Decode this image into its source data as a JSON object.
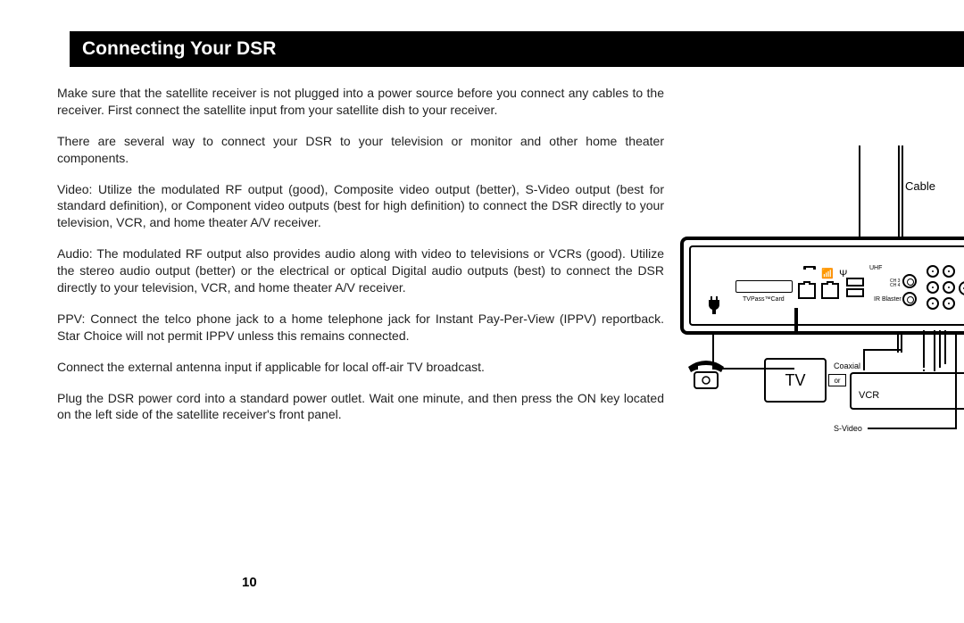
{
  "header": {
    "title": "Connecting Your DSR"
  },
  "paragraphs": {
    "p1": "Make sure that the satellite receiver is not plugged into a power source before you connect any cables to the receiver. First connect the satellite input from your satellite dish to your receiver.",
    "p2": "There are several way to connect your DSR to your television or monitor and other home theater components.",
    "p3": "Video: Utilize the modulated RF output (good), Composite video output (better), S-Video output (best for standard definition), or Component video outputs (best for high definition) to connect the DSR directly to your television, VCR, and home theater A/V receiver.",
    "p4": "Audio: The modulated RF output also provides audio along with video to televisions or VCRs (good). Utilize the stereo audio output (better) or the electrical or optical Digital audio outputs (best) to connect the DSR directly to your television, VCR, and home theater A/V receiver.",
    "p5": "PPV: Connect the telco phone jack to a home telephone jack for Instant Pay-Per-View (IPPV) reportback.  Star Choice will not permit IPPV unless this remains connected.",
    "p6": "Connect the external antenna input if applicable for local off-air TV broadcast.",
    "p7": "Plug the DSR power cord into a standard power outlet. Wait one minute, and then press the ON key located on the left side of the satellite receiver's front panel."
  },
  "page_number": "10",
  "diagram": {
    "cable_label": "Cable",
    "card_slot": "TVPass™Card",
    "uhf": "UHF",
    "ir_blaster": "IR\nBlaster",
    "ch3": "CH 3",
    "ch4": "CH 4",
    "tv": "TV",
    "or": "or",
    "vcr": "VCR",
    "coaxial": "Coaxial",
    "svideo": "S-Video"
  }
}
